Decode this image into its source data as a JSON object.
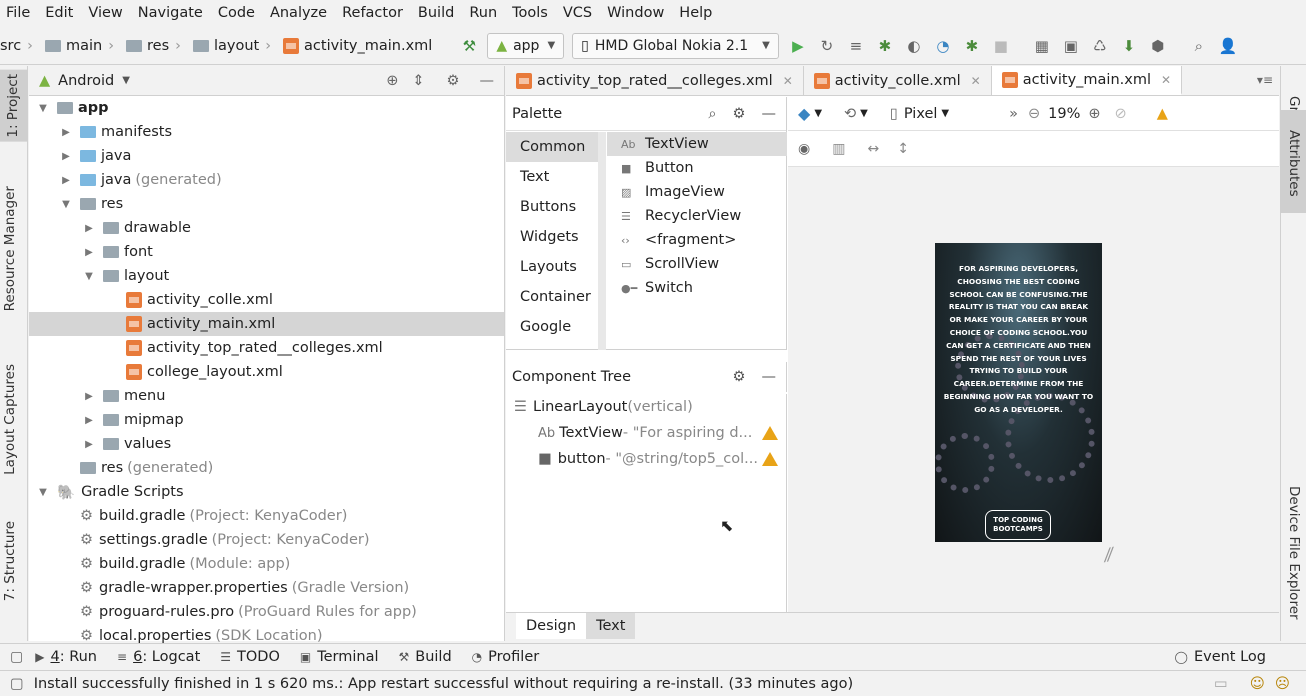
{
  "menu": [
    "File",
    "Edit",
    "View",
    "Navigate",
    "Code",
    "Analyze",
    "Refactor",
    "Build",
    "Run",
    "Tools",
    "VCS",
    "Window",
    "Help"
  ],
  "breadcrumb": [
    "src",
    "main",
    "res",
    "layout",
    "activity_main.xml"
  ],
  "run_config": "app",
  "device": "HMD Global Nokia 2.1",
  "left_tabs": [
    "1: Project",
    "Resource Manager",
    "Layout Captures",
    "7: Structure"
  ],
  "right_tabs": [
    "Gradle",
    "Attributes",
    "Device File Explorer"
  ],
  "project": {
    "view_label": "Android",
    "tree": [
      {
        "label": "app",
        "extra": "",
        "indent": 0,
        "open": true,
        "bold": true
      },
      {
        "label": "manifests",
        "extra": "",
        "indent": 1,
        "open": false
      },
      {
        "label": "java",
        "extra": "",
        "indent": 1,
        "open": false
      },
      {
        "label": "java",
        "extra": "(generated)",
        "indent": 1,
        "open": false
      },
      {
        "label": "res",
        "extra": "",
        "indent": 1,
        "open": true
      },
      {
        "label": "drawable",
        "extra": "",
        "indent": 2,
        "open": false
      },
      {
        "label": "font",
        "extra": "",
        "indent": 2,
        "open": false
      },
      {
        "label": "layout",
        "extra": "",
        "indent": 2,
        "open": true
      },
      {
        "label": "activity_colle.xml",
        "extra": "",
        "indent": 3,
        "file": true
      },
      {
        "label": "activity_main.xml",
        "extra": "",
        "indent": 3,
        "file": true,
        "selected": true
      },
      {
        "label": "activity_top_rated__colleges.xml",
        "extra": "",
        "indent": 3,
        "file": true
      },
      {
        "label": "college_layout.xml",
        "extra": "",
        "indent": 3,
        "file": true
      },
      {
        "label": "menu",
        "extra": "",
        "indent": 2,
        "open": false
      },
      {
        "label": "mipmap",
        "extra": "",
        "indent": 2,
        "open": false
      },
      {
        "label": "values",
        "extra": "",
        "indent": 2,
        "open": false
      },
      {
        "label": "res",
        "extra": "(generated)",
        "indent": 1,
        "nochev": true
      },
      {
        "label": "Gradle Scripts",
        "extra": "",
        "indent": 0,
        "open": true
      },
      {
        "label": "build.gradle",
        "extra": "(Project: KenyaCoder)",
        "indent": 1,
        "nochev": true
      },
      {
        "label": "settings.gradle",
        "extra": "(Project: KenyaCoder)",
        "indent": 1,
        "nochev": true
      },
      {
        "label": "build.gradle",
        "extra": "(Module: app)",
        "indent": 1,
        "nochev": true
      },
      {
        "label": "gradle-wrapper.properties",
        "extra": "(Gradle Version)",
        "indent": 1,
        "nochev": true
      },
      {
        "label": "proguard-rules.pro",
        "extra": "(ProGuard Rules for app)",
        "indent": 1,
        "nochev": true
      },
      {
        "label": "local.properties",
        "extra": "(SDK Location)",
        "indent": 1,
        "nochev": true
      }
    ]
  },
  "editor_tabs": [
    "activity_top_rated__colleges.xml",
    "activity_colle.xml",
    "activity_main.xml"
  ],
  "palette": {
    "title": "Palette",
    "categories": [
      "Common",
      "Text",
      "Buttons",
      "Widgets",
      "Layouts",
      "Container",
      "Google"
    ],
    "items": [
      {
        "icon": "Ab",
        "label": "TextView"
      },
      {
        "icon": "■",
        "label": "Button"
      },
      {
        "icon": "▨",
        "label": "ImageView"
      },
      {
        "icon": "☰",
        "label": "RecyclerView"
      },
      {
        "icon": "‹›",
        "label": "<fragment>"
      },
      {
        "icon": "▭",
        "label": "ScrollView"
      },
      {
        "icon": "●━",
        "label": "Switch"
      }
    ]
  },
  "component_tree": {
    "title": "Component Tree",
    "root": "LinearLayout",
    "root_extra": "(vertical)",
    "children": [
      {
        "icon": "Ab",
        "label": "TextView",
        "extra": "- \"For aspiring d..."
      },
      {
        "icon": "■",
        "label": "button",
        "extra": "- \"@string/top5_col..."
      }
    ]
  },
  "design": {
    "device_label": "Pixel",
    "zoom": "19%",
    "phone_text": "For aspiring developers, choosing the best coding school can be confusing.The reality is that you can break or make your career by your choice of coding school.You can get a certificate and then spend the rest of your lives trying to build your career.Determine from the beginning how far you want to go as a developer.",
    "phone_button": "TOP CODING BOOTCAMPS",
    "tabs": [
      "Design",
      "Text"
    ]
  },
  "tool_windows": [
    {
      "num": "4",
      "label": ": Run"
    },
    {
      "num": "6",
      "label": ": Logcat"
    },
    {
      "num": "",
      "label": "TODO"
    },
    {
      "num": "",
      "label": "Terminal"
    },
    {
      "num": "",
      "label": "Build"
    },
    {
      "num": "",
      "label": "Profiler"
    }
  ],
  "event_log": "Event Log",
  "status": "Install successfully finished in 1 s 620 ms.: App restart successful without requiring a re-install. (33 minutes ago)"
}
